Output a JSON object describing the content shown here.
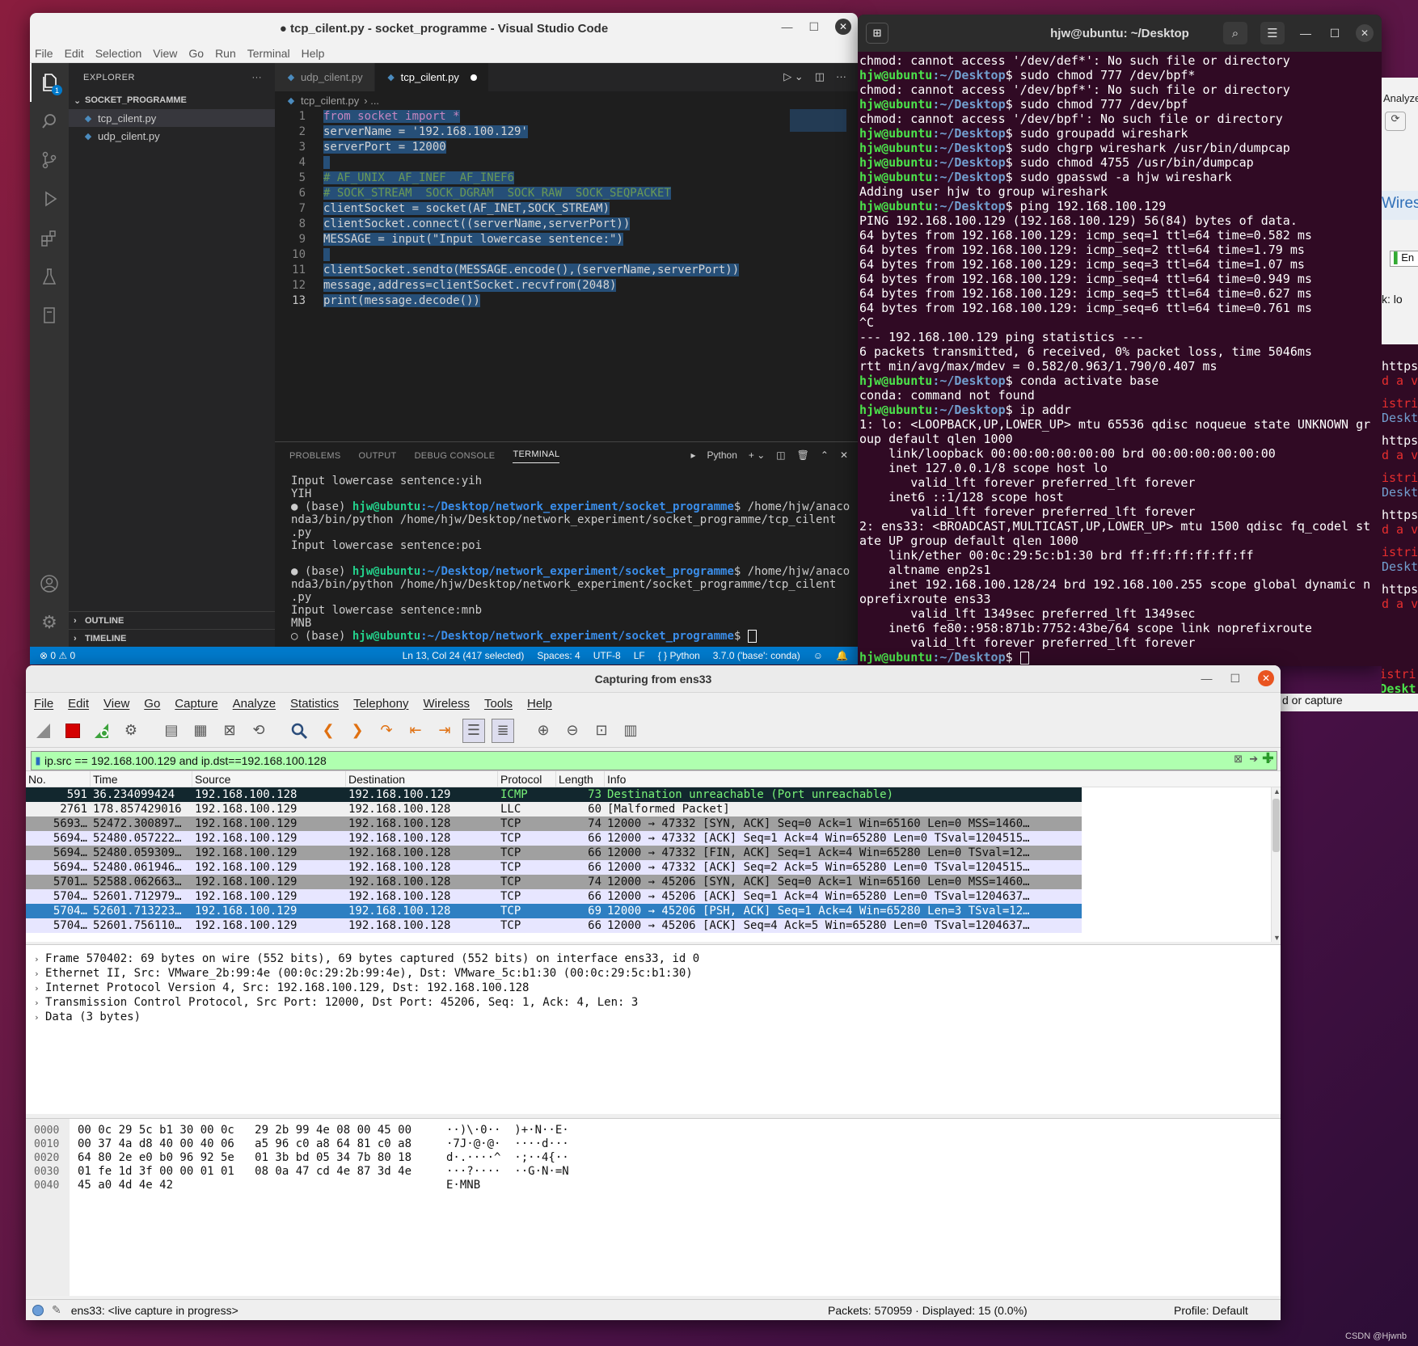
{
  "vscode": {
    "title": "● tcp_cilent.py - socket_programme - Visual Studio Code",
    "menu": [
      "File",
      "Edit",
      "Selection",
      "View",
      "Go",
      "Run",
      "Terminal",
      "Help"
    ],
    "explorer_label": "EXPLORER",
    "explorer_more": "···",
    "folder": "SOCKET_PROGRAMME",
    "files": [
      "tcp_cilent.py",
      "udp_cilent.py"
    ],
    "outline": "OUTLINE",
    "timeline": "TIMELINE",
    "tabs": [
      "udp_cilent.py",
      "tcp_cilent.py"
    ],
    "breadcrumb": "tcp_cilent.py",
    "breadcrumb_more": "›  ...",
    "badge": "1",
    "code": [
      {
        "n": "1",
        "t": "from socket import *"
      },
      {
        "n": "2",
        "t": "serverName = '192.168.100.129'"
      },
      {
        "n": "3",
        "t": "serverPort = 12000"
      },
      {
        "n": "4",
        "t": ""
      },
      {
        "n": "5",
        "t": "# AF_UNIX  AF_INEF  AF_INEF6"
      },
      {
        "n": "6",
        "t": "# SOCK_STREAM  SOCK_DGRAM  SOCK_RAW  SOCK_SEQPACKET"
      },
      {
        "n": "7",
        "t": "clientSocket = socket(AF_INET,SOCK_STREAM)"
      },
      {
        "n": "8",
        "t": "clientSocket.connect((serverName,serverPort))"
      },
      {
        "n": "9",
        "t": "MESSAGE = input(\"Input lowercase sentence:\")"
      },
      {
        "n": "10",
        "t": ""
      },
      {
        "n": "11",
        "t": "clientSocket.sendto(MESSAGE.encode(),(serverName,serverPort))"
      },
      {
        "n": "12",
        "t": "message,address=clientSocket.recvfrom(2048)"
      },
      {
        "n": "13",
        "t": "print(message.decode())"
      }
    ],
    "panel_tabs": [
      "PROBLEMS",
      "OUTPUT",
      "DEBUG CONSOLE",
      "TERMINAL"
    ],
    "panel_shell": "Python",
    "terminal": {
      "l1": "Input lowercase sentence:yih",
      "l2": "YIH",
      "base": "● (base) ",
      "user": "hjw@ubuntu",
      "path": ":~/Desktop/network_experiment/socket_programme",
      "cmd": "$ /home/hjw/anaco",
      "cont1": "nda3/bin/python /home/hjw/Desktop/network_experiment/socket_programme/tcp_cilent",
      "cont2": ".py",
      "l3": "Input lowercase sentence:poi",
      "l4": "Input lowercase sentence:mnb",
      "l5": "MNB",
      "last": "○ (base) "
    },
    "status": {
      "errors": "⊗ 0 ⚠ 0",
      "position": "Ln 13, Col 24 (417 selected)",
      "spaces": "Spaces: 4",
      "encoding": "UTF-8",
      "eol": "LF",
      "lang": "Python",
      "interp": "3.7.0 ('base': conda)"
    }
  },
  "terminal": {
    "title": "hjw@ubuntu: ~/Desktop",
    "prompt_user": "hjw@ubuntu",
    "prompt_path": ":~/Desktop",
    "lines": [
      {
        "o": "chmod: cannot access '/dev/def*': No such file or directory"
      },
      {
        "c": "sudo chmod 777 /dev/bpf*"
      },
      {
        "o": "chmod: cannot access '/dev/bpf*': No such file or directory"
      },
      {
        "c": "sudo chmod 777 /dev/bpf"
      },
      {
        "o": "chmod: cannot access '/dev/bpf': No such file or directory"
      },
      {
        "c": "sudo groupadd wireshark"
      },
      {
        "c": "sudo chgrp wireshark /usr/bin/dumpcap"
      },
      {
        "c": "sudo chmod 4755 /usr/bin/dumpcap"
      },
      {
        "c": "sudo gpasswd -a hjw wireshark"
      },
      {
        "o": "Adding user hjw to group wireshark"
      },
      {
        "c": "ping 192.168.100.129"
      },
      {
        "o": "PING 192.168.100.129 (192.168.100.129) 56(84) bytes of data."
      },
      {
        "o": "64 bytes from 192.168.100.129: icmp_seq=1 ttl=64 time=0.582 ms"
      },
      {
        "o": "64 bytes from 192.168.100.129: icmp_seq=2 ttl=64 time=1.79 ms"
      },
      {
        "o": "64 bytes from 192.168.100.129: icmp_seq=3 ttl=64 time=1.07 ms"
      },
      {
        "o": "64 bytes from 192.168.100.129: icmp_seq=4 ttl=64 time=0.949 ms"
      },
      {
        "o": "64 bytes from 192.168.100.129: icmp_seq=5 ttl=64 time=0.627 ms"
      },
      {
        "o": "64 bytes from 192.168.100.129: icmp_seq=6 ttl=64 time=0.761 ms"
      },
      {
        "o": "^C"
      },
      {
        "o": "--- 192.168.100.129 ping statistics ---"
      },
      {
        "o": "6 packets transmitted, 6 received, 0% packet loss, time 5046ms"
      },
      {
        "o": "rtt min/avg/max/mdev = 0.582/0.963/1.790/0.407 ms"
      },
      {
        "c": "conda activate base"
      },
      {
        "o": "conda: command not found"
      },
      {
        "c": "ip addr"
      },
      {
        "o": "1: lo: <LOOPBACK,UP,LOWER_UP> mtu 65536 qdisc noqueue state UNKNOWN gr"
      },
      {
        "o": "oup default qlen 1000"
      },
      {
        "o": "    link/loopback 00:00:00:00:00:00 brd 00:00:00:00:00:00"
      },
      {
        "o": "    inet 127.0.0.1/8 scope host lo"
      },
      {
        "o": "       valid_lft forever preferred_lft forever"
      },
      {
        "o": "    inet6 ::1/128 scope host"
      },
      {
        "o": "       valid_lft forever preferred_lft forever"
      },
      {
        "o": "2: ens33: <BROADCAST,MULTICAST,UP,LOWER_UP> mtu 1500 qdisc fq_codel st"
      },
      {
        "o": "ate UP group default qlen 1000"
      },
      {
        "o": "    link/ether 00:0c:29:5c:b1:30 brd ff:ff:ff:ff:ff:ff"
      },
      {
        "o": "    altname enp2s1"
      },
      {
        "o": "    inet 192.168.100.128/24 brd 192.168.100.255 scope global dynamic n"
      },
      {
        "o": "oprefixroute ens33"
      },
      {
        "o": "       valid_lft 1349sec preferred_lft 1349sec"
      },
      {
        "o": "    inet6 fe80::958:871b:7752:43be/64 scope link noprefixroute"
      },
      {
        "o": "       valid_lft forever preferred_lft forever"
      },
      {
        "c": ""
      }
    ]
  },
  "peek": {
    "analyze": "Analyze",
    "wiresh": "Wiresh",
    "en": "En",
    "lo": "k: lo",
    "items": [
      "https",
      "d a ve",
      "istri",
      "Deskt",
      "https",
      "d a ve",
      "istri",
      "Deskt",
      "https",
      "d a ve",
      "istri",
      "Deskt",
      "https",
      "d a ve"
    ],
    "no_match": "No matching distri",
    "hjw": "hjw@ubuntu:~/Deskt",
    "capture": "d or capture"
  },
  "wireshark": {
    "title": "Capturing from ens33",
    "menu": [
      "File",
      "Edit",
      "View",
      "Go",
      "Capture",
      "Analyze",
      "Statistics",
      "Telephony",
      "Wireless",
      "Tools",
      "Help"
    ],
    "filter": "ip.src == 192.168.100.129 and ip.dst==192.168.100.128",
    "columns": [
      "No.",
      "Time",
      "Source",
      "Destination",
      "Protocol",
      "Length",
      "Info"
    ],
    "packets": [
      {
        "no": "591",
        "time": "36.234099424",
        "src": "192.168.100.128",
        "dst": "192.168.100.129",
        "proto": "ICMP",
        "len": "73",
        "info": "Destination unreachable (Port unreachable)",
        "cls": "icmp"
      },
      {
        "no": "2761",
        "time": "178.857429016",
        "src": "192.168.100.129",
        "dst": "192.168.100.128",
        "proto": "LLC",
        "len": "60",
        "info": "[Malformed Packet]",
        "cls": "llc"
      },
      {
        "no": "5693…",
        "time": "52472.300897…",
        "src": "192.168.100.129",
        "dst": "192.168.100.128",
        "proto": "TCP",
        "len": "74",
        "info": "12000 → 47332 [SYN, ACK] Seq=0 Ack=1 Win=65160 Len=0 MSS=1460…",
        "cls": "tcp-a"
      },
      {
        "no": "5694…",
        "time": "52480.057222…",
        "src": "192.168.100.129",
        "dst": "192.168.100.128",
        "proto": "TCP",
        "len": "66",
        "info": "12000 → 47332 [ACK] Seq=1 Ack=4 Win=65280 Len=0 TSval=1204515…",
        "cls": "tcp-b"
      },
      {
        "no": "5694…",
        "time": "52480.059309…",
        "src": "192.168.100.129",
        "dst": "192.168.100.128",
        "proto": "TCP",
        "len": "66",
        "info": "12000 → 47332 [FIN, ACK] Seq=1 Ack=4 Win=65280 Len=0 TSval=12…",
        "cls": "tcp-a"
      },
      {
        "no": "5694…",
        "time": "52480.061946…",
        "src": "192.168.100.129",
        "dst": "192.168.100.128",
        "proto": "TCP",
        "len": "66",
        "info": "12000 → 47332 [ACK] Seq=2 Ack=5 Win=65280 Len=0 TSval=1204515…",
        "cls": "tcp-b"
      },
      {
        "no": "5701…",
        "time": "52588.062663…",
        "src": "192.168.100.129",
        "dst": "192.168.100.128",
        "proto": "TCP",
        "len": "74",
        "info": "12000 → 45206 [SYN, ACK] Seq=0 Ack=1 Win=65160 Len=0 MSS=1460…",
        "cls": "tcp-a"
      },
      {
        "no": "5704…",
        "time": "52601.712979…",
        "src": "192.168.100.129",
        "dst": "192.168.100.128",
        "proto": "TCP",
        "len": "66",
        "info": "12000 → 45206 [ACK] Seq=1 Ack=4 Win=65280 Len=0 TSval=1204637…",
        "cls": "tcp-b"
      },
      {
        "no": "5704…",
        "time": "52601.713223…",
        "src": "192.168.100.129",
        "dst": "192.168.100.128",
        "proto": "TCP",
        "len": "69",
        "info": "12000 → 45206 [PSH, ACK] Seq=1 Ack=4 Win=65280 Len=3 TSval=12…",
        "cls": "sel"
      },
      {
        "no": "5704…",
        "time": "52601.756110…",
        "src": "192.168.100.129",
        "dst": "192.168.100.128",
        "proto": "TCP",
        "len": "66",
        "info": "12000 → 45206 [ACK] Seq=4 Ack=5 Win=65280 Len=0 TSval=1204637…",
        "cls": "tcp-b"
      }
    ],
    "details": [
      "Frame 570402: 69 bytes on wire (552 bits), 69 bytes captured (552 bits) on interface ens33, id 0",
      "Ethernet II, Src: VMware_2b:99:4e (00:0c:29:2b:99:4e), Dst: VMware_5c:b1:30 (00:0c:29:5c:b1:30)",
      "Internet Protocol Version 4, Src: 192.168.100.129, Dst: 192.168.100.128",
      "Transmission Control Protocol, Src Port: 12000, Dst Port: 45206, Seq: 1, Ack: 4, Len: 3",
      "Data (3 bytes)"
    ],
    "bytes": [
      {
        "off": "0000",
        "hex": "00 0c 29 5c b1 30 00 0c   29 2b 99 4e 08 00 45 00",
        "asc": "··)\\·0··  )+·N··E·"
      },
      {
        "off": "0010",
        "hex": "00 37 4a d8 40 00 40 06   a5 96 c0 a8 64 81 c0 a8",
        "asc": "·7J·@·@·  ····d···"
      },
      {
        "off": "0020",
        "hex": "64 80 2e e0 b0 96 92 5e   01 3b bd 05 34 7b 80 18",
        "asc": "d·.····^  ·;··4{··"
      },
      {
        "off": "0030",
        "hex": "01 fe 1d 3f 00 00 01 01   08 0a 47 cd 4e 87 3d 4e",
        "asc": "···?····  ··G·N·=N"
      },
      {
        "off": "0040",
        "hex": "45 a0 4d 4e 42",
        "asc": "E·MNB"
      }
    ],
    "status_left": "ens33: <live capture in progress>",
    "status_packets": "Packets: 570959 · Displayed: 15 (0.0%)",
    "status_profile": "Profile: Default"
  },
  "watermark": "CSDN @Hjwnb"
}
